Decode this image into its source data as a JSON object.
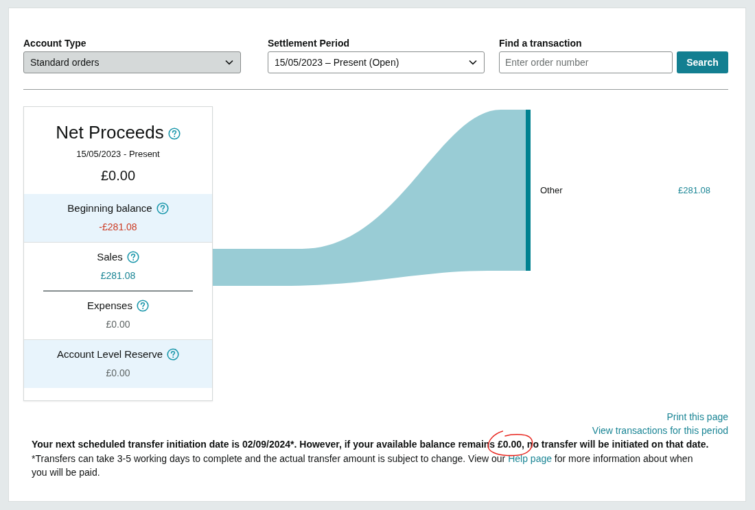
{
  "filters": [
    {
      "label": "Account Type",
      "value": "Standard orders",
      "disabled": true
    },
    {
      "label": "Settlement Period",
      "value": "15/05/2023 – Present (Open)",
      "disabled": false
    }
  ],
  "search": {
    "label": "Find a transaction",
    "placeholder": "Enter order number",
    "button": "Search"
  },
  "summary": {
    "title": "Net Proceeds",
    "period": "15/05/2023 - Present",
    "total": "£0.00",
    "sections": [
      {
        "highlighted": true,
        "items": [
          {
            "label": "Beginning balance",
            "value": "-£281.08",
            "color": "#cc3a22"
          }
        ]
      },
      {
        "highlighted": false,
        "items": [
          {
            "label": "Sales",
            "value": "£281.08",
            "color": "#1a8595"
          },
          {
            "label": "Expenses",
            "value": "£0.00",
            "color": "#5f6565"
          }
        ]
      },
      {
        "highlighted": true,
        "items": [
          {
            "label": "Account Level Reserve",
            "value": "£0.00",
            "color": "#5f6565"
          }
        ]
      }
    ]
  },
  "flow": {
    "nodes": [
      {
        "label": "Other",
        "value": "£281.08"
      }
    ]
  },
  "links": [
    "Print this page",
    "View transactions for this period"
  ],
  "notice": {
    "parts": [
      {
        "text": "Your next scheduled transfer initiation date is 02/09/2024*. However, if your available balance remains ",
        "circled": false
      },
      {
        "text": "£0.00,",
        "circled": true
      },
      {
        "text": " no transfer will be initiated on that date.",
        "circled": false
      }
    ]
  },
  "footnote": {
    "before": "*Transfers can take 3-5 working days to complete and the actual transfer amount is subject to change. View our ",
    "link": "Help page",
    "after": " for more information about when you will be paid."
  }
}
